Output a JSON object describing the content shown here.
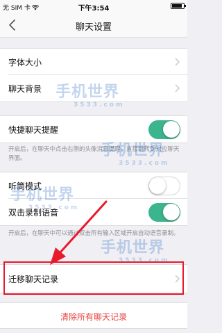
{
  "status_bar": {
    "carrier": "无 SIM 卡",
    "time": "下午3:54"
  },
  "nav": {
    "title": "聊天设置"
  },
  "groups": {
    "font_size": "字体大小",
    "chat_background": "聊天背景",
    "quick_reminder": "快捷聊天提醒",
    "quick_reminder_note": "开启后，在聊天中点击右侧的头像消息提醒，直接跳转到对应聊天界面。",
    "earpiece_mode": "听筒模式",
    "double_tap_voice": "双击录制语音",
    "double_tap_note": "开启后，在聊天中可以通过双击所有输入区域开启自动语音录制。",
    "migrate_chat": "迁移聊天记录",
    "clear_all": "清除所有聊天记录"
  },
  "toggles": {
    "quick_reminder": true,
    "earpiece_mode": false,
    "double_tap_voice": true
  },
  "watermark": {
    "main": "手机世界",
    "sub": "3533.com"
  },
  "colors": {
    "accent_green": "#3bb58e",
    "danger_red": "#e64340",
    "highlight_red": "#e8192c"
  }
}
